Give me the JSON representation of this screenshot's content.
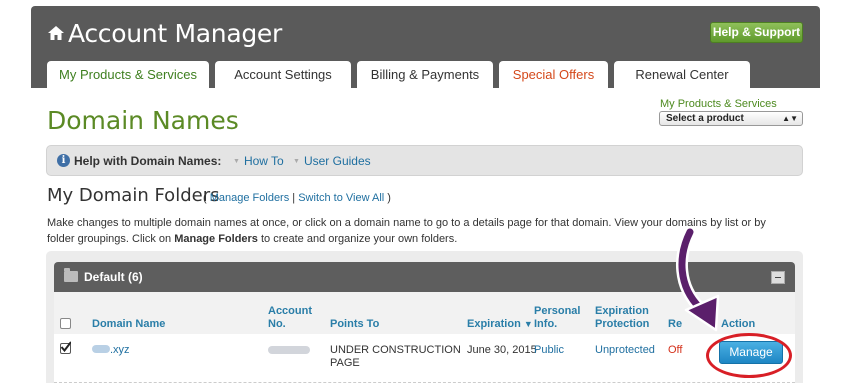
{
  "header": {
    "title": "Account Manager",
    "help_button": "Help & Support"
  },
  "tabs": [
    {
      "label": "My Products & Services",
      "active": true
    },
    {
      "label": "Account Settings"
    },
    {
      "label": "Billing & Payments"
    },
    {
      "label": "Special Offers",
      "color": "#d4481a"
    },
    {
      "label": "Renewal Center"
    }
  ],
  "page": {
    "title": "Domain Names",
    "product_selector": {
      "label": "My Products & Services",
      "selected": "Select a product"
    }
  },
  "helpbar": {
    "label": "Help with Domain Names:",
    "links": [
      "How To",
      "User Guides"
    ]
  },
  "folders": {
    "title": "My Domain Folders",
    "open_paren": "(",
    "manage_link": "Manage Folders",
    "separator": "|",
    "switch_link": "Switch to View All",
    "close_paren": ")",
    "description_pre": "Make changes to multiple domain names at once, or click on a domain name to go to a details page for that domain. View your domains by list or by folder groupings. Click on ",
    "description_bold": "Manage Folders",
    "description_post": " to create and organize your own folders."
  },
  "panel": {
    "folder_name": "Default (6)",
    "columns": {
      "domain": "Domain Name",
      "account_1": "Account",
      "account_2": "No.",
      "points": "Points To",
      "expiration": "Expiration",
      "expiration_sort": "▼",
      "personal_1": "Personal",
      "personal_2": "Info.",
      "exp_protect_1": "Expiration",
      "exp_protect_2": "Protection",
      "renew_partial": "Re",
      "action": "Action"
    },
    "rows": [
      {
        "checked": true,
        "domain_suffix": ".xyz",
        "points_1": "UNDER CONSTRUCTION",
        "points_2": "PAGE",
        "expiration": "June 30, 2015",
        "personal": "Public",
        "protection": "Unprotected",
        "renew": "Off",
        "action": "Manage"
      }
    ]
  },
  "colors": {
    "header_bg": "#5a5a5a",
    "brand_green": "#5b8a25",
    "link_blue": "#1f6fa0",
    "annotation_arrow": "#5b1f6b",
    "annotation_circle": "#d81f26"
  }
}
